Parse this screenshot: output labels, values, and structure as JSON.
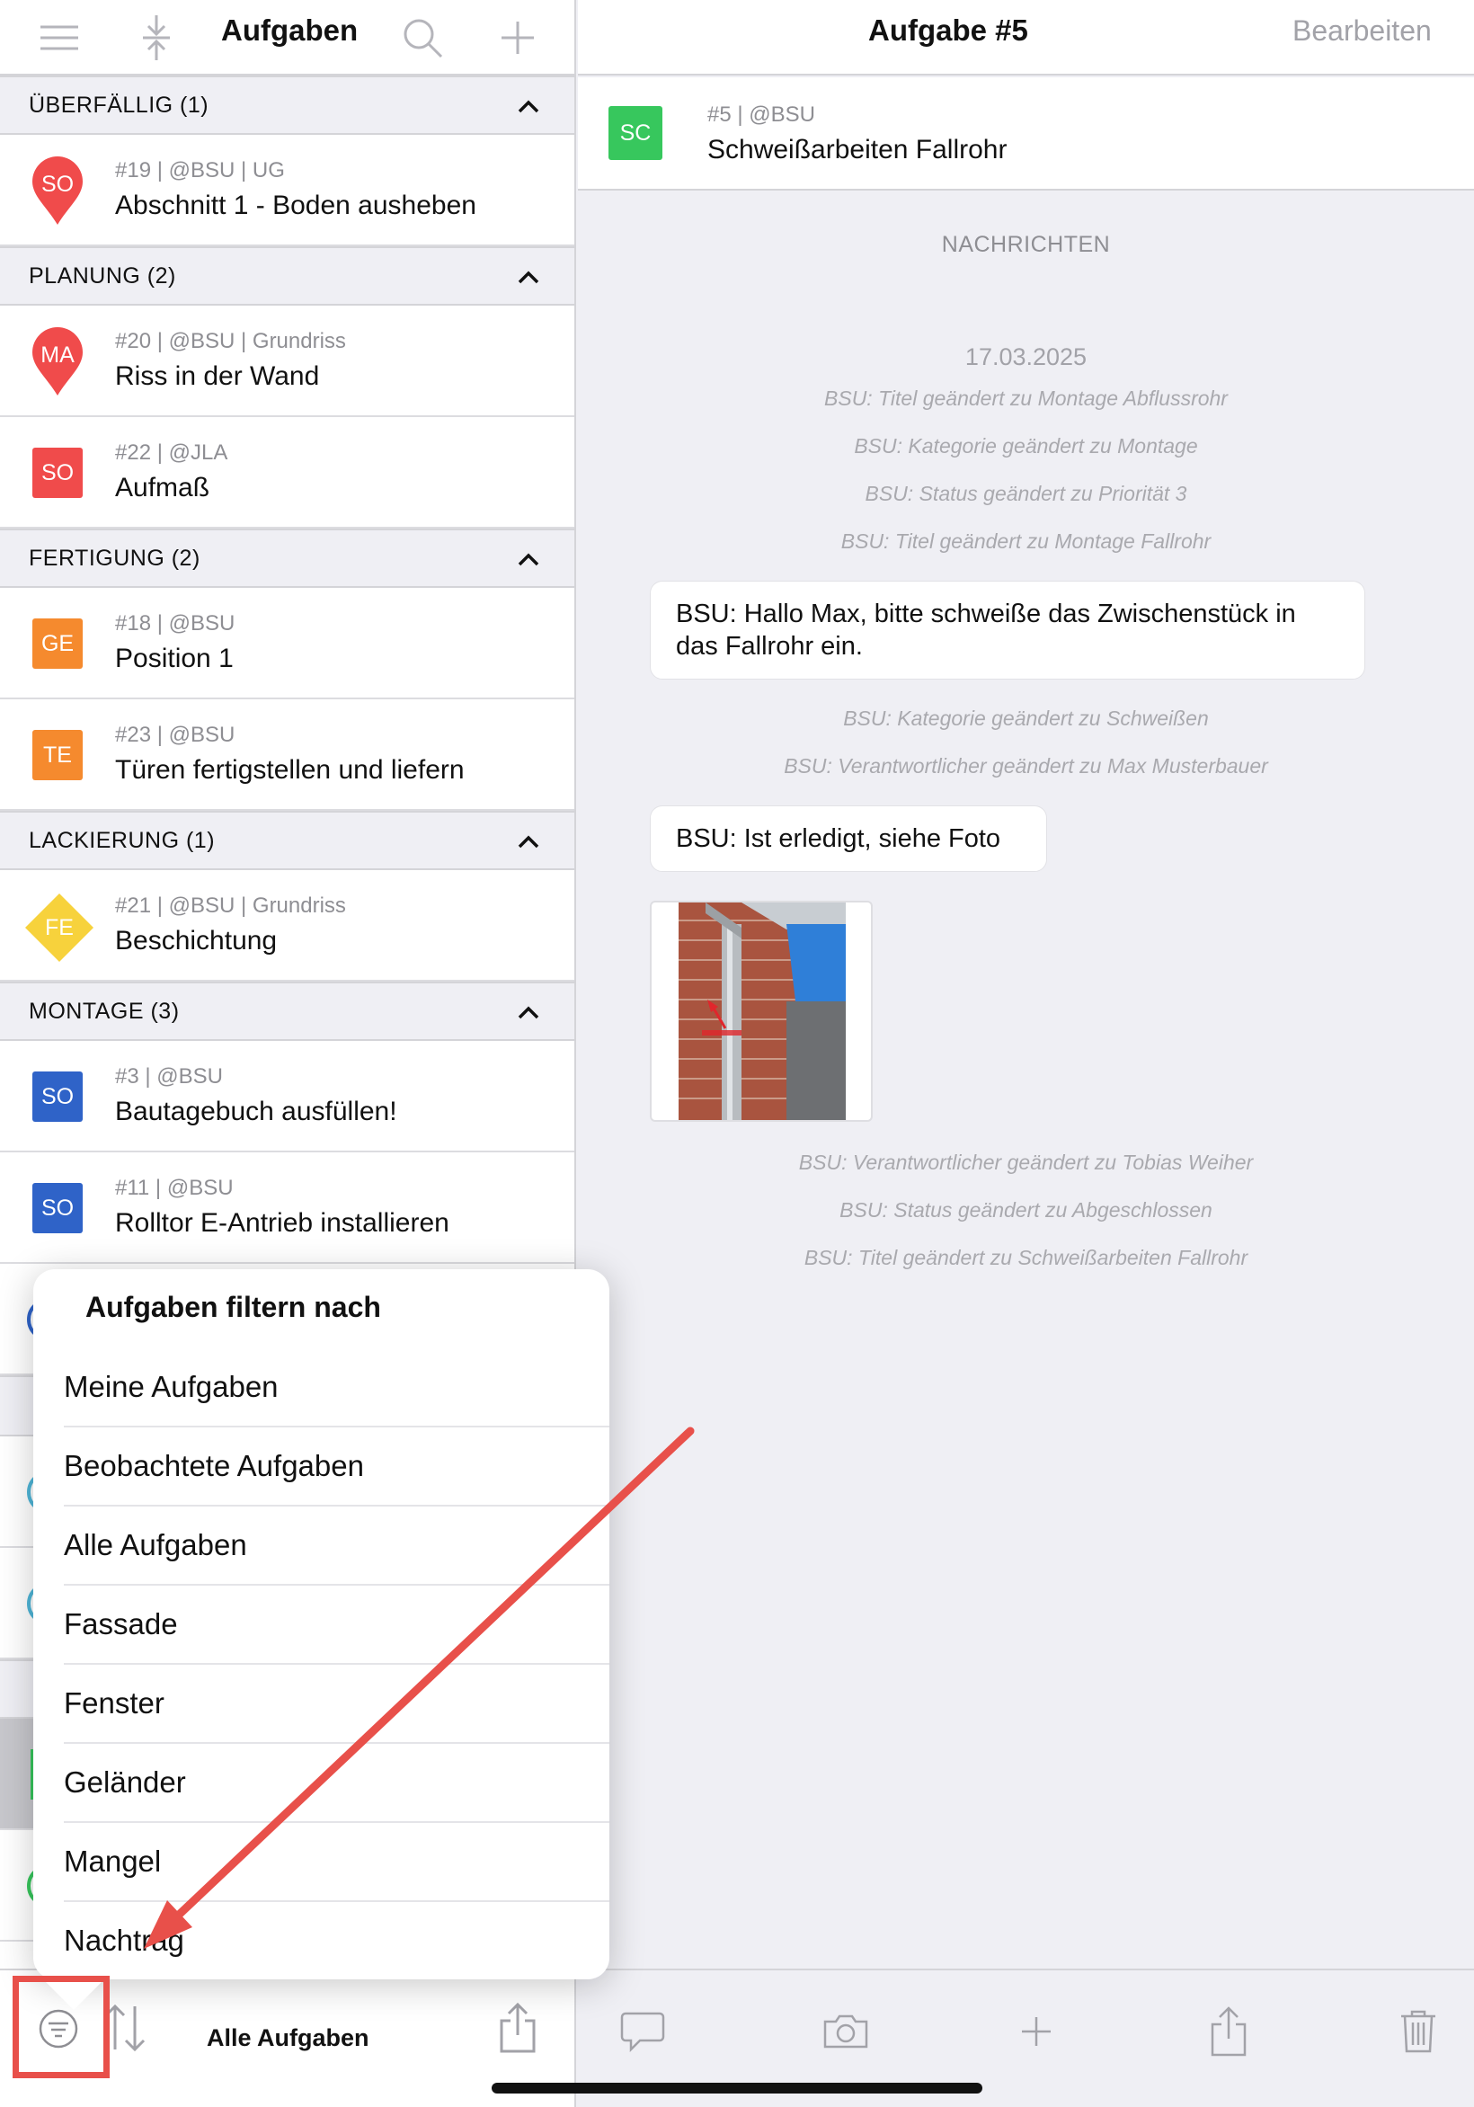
{
  "left": {
    "title": "Aufgaben",
    "sections": [
      {
        "title": "ÜBERFÄLLIG (1)",
        "tasks": [
          {
            "code": "SO",
            "meta": "#19 | @BSU | UG",
            "name": "Abschnitt 1 - Boden ausheben",
            "color": "#f04b4b",
            "shape": "pin"
          }
        ]
      },
      {
        "title": "PLANUNG (2)",
        "tasks": [
          {
            "code": "MA",
            "meta": "#20 | @BSU | Grundriss",
            "name": "Riss in der Wand",
            "color": "#f04b4b",
            "shape": "pin"
          },
          {
            "code": "SO",
            "meta": "#22 | @JLA",
            "name": "Aufmaß",
            "color": "#f04b4b",
            "shape": "square"
          }
        ]
      },
      {
        "title": "FERTIGUNG (2)",
        "tasks": [
          {
            "code": "GE",
            "meta": "#18 | @BSU",
            "name": "Position 1",
            "color": "#f58a2e",
            "shape": "square"
          },
          {
            "code": "TE",
            "meta": "#23 | @BSU",
            "name": "Türen fertigstellen und liefern",
            "color": "#f58a2e",
            "shape": "square"
          }
        ]
      },
      {
        "title": "LACKIERUNG (1)",
        "tasks": [
          {
            "code": "FE",
            "meta": "#21 | @BSU | Grundriss",
            "name": "Beschichtung",
            "color": "#f7d23c",
            "shape": "diamond"
          }
        ]
      },
      {
        "title": "MONTAGE (3)",
        "tasks": [
          {
            "code": "SO",
            "meta": "#3 | @BSU",
            "name": "Bautagebuch ausfüllen!",
            "color": "#2f63c8",
            "shape": "square"
          },
          {
            "code": "SO",
            "meta": "#11 | @BSU",
            "name": "Rolltor E-Antrieb installieren",
            "color": "#2f63c8",
            "shape": "square"
          }
        ]
      }
    ],
    "bottom_label": "Alle Aufgaben"
  },
  "right": {
    "title": "Aufgabe #5",
    "edit_label": "Bearbeiten",
    "task": {
      "code": "SC",
      "meta": "#5 | @BSU",
      "name": "Schweißarbeiten Fallrohr"
    },
    "messages_header": "NACHRICHTEN",
    "date": "17.03.2025",
    "log1": [
      "BSU: Titel geändert zu Montage Abflussrohr",
      "BSU: Kategorie geändert zu Montage",
      "BSU: Status geändert zu Priorität 3",
      "BSU: Titel geändert zu Montage Fallrohr"
    ],
    "bubble1": "BSU: Hallo Max, bitte schweiße das Zwischenstück in das Fallrohr ein.",
    "log2": [
      "BSU: Kategorie geändert zu Schweißen",
      "BSU: Verantwortlicher geändert zu Max Musterbauer"
    ],
    "bubble2": "BSU: Ist erledigt, siehe Foto",
    "log3": [
      "BSU: Verantwortlicher geändert zu Tobias Weiher",
      "BSU: Status geändert zu Abgeschlossen",
      "BSU: Titel geändert zu Schweißarbeiten Fallrohr"
    ]
  },
  "popover": {
    "title": "Aufgaben filtern nach",
    "items": [
      "Meine Aufgaben",
      "Beobachtete Aufgaben",
      "Alle Aufgaben",
      "Fassade",
      "Fenster",
      "Geländer",
      "Mangel",
      "Nachtrag"
    ]
  },
  "colors": {
    "accent": "#e8504a",
    "sc_green": "#37c75d"
  }
}
